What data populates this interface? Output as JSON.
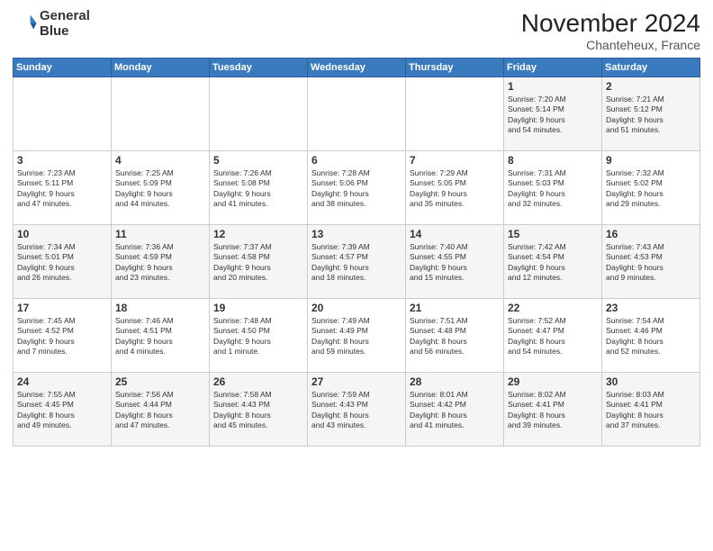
{
  "logo": {
    "line1": "General",
    "line2": "Blue"
  },
  "title": "November 2024",
  "location": "Chanteheux, France",
  "days_of_week": [
    "Sunday",
    "Monday",
    "Tuesday",
    "Wednesday",
    "Thursday",
    "Friday",
    "Saturday"
  ],
  "weeks": [
    [
      {
        "day": "",
        "info": ""
      },
      {
        "day": "",
        "info": ""
      },
      {
        "day": "",
        "info": ""
      },
      {
        "day": "",
        "info": ""
      },
      {
        "day": "",
        "info": ""
      },
      {
        "day": "1",
        "info": "Sunrise: 7:20 AM\nSunset: 5:14 PM\nDaylight: 9 hours\nand 54 minutes."
      },
      {
        "day": "2",
        "info": "Sunrise: 7:21 AM\nSunset: 5:12 PM\nDaylight: 9 hours\nand 51 minutes."
      }
    ],
    [
      {
        "day": "3",
        "info": "Sunrise: 7:23 AM\nSunset: 5:11 PM\nDaylight: 9 hours\nand 47 minutes."
      },
      {
        "day": "4",
        "info": "Sunrise: 7:25 AM\nSunset: 5:09 PM\nDaylight: 9 hours\nand 44 minutes."
      },
      {
        "day": "5",
        "info": "Sunrise: 7:26 AM\nSunset: 5:08 PM\nDaylight: 9 hours\nand 41 minutes."
      },
      {
        "day": "6",
        "info": "Sunrise: 7:28 AM\nSunset: 5:06 PM\nDaylight: 9 hours\nand 38 minutes."
      },
      {
        "day": "7",
        "info": "Sunrise: 7:29 AM\nSunset: 5:05 PM\nDaylight: 9 hours\nand 35 minutes."
      },
      {
        "day": "8",
        "info": "Sunrise: 7:31 AM\nSunset: 5:03 PM\nDaylight: 9 hours\nand 32 minutes."
      },
      {
        "day": "9",
        "info": "Sunrise: 7:32 AM\nSunset: 5:02 PM\nDaylight: 9 hours\nand 29 minutes."
      }
    ],
    [
      {
        "day": "10",
        "info": "Sunrise: 7:34 AM\nSunset: 5:01 PM\nDaylight: 9 hours\nand 26 minutes."
      },
      {
        "day": "11",
        "info": "Sunrise: 7:36 AM\nSunset: 4:59 PM\nDaylight: 9 hours\nand 23 minutes."
      },
      {
        "day": "12",
        "info": "Sunrise: 7:37 AM\nSunset: 4:58 PM\nDaylight: 9 hours\nand 20 minutes."
      },
      {
        "day": "13",
        "info": "Sunrise: 7:39 AM\nSunset: 4:57 PM\nDaylight: 9 hours\nand 18 minutes."
      },
      {
        "day": "14",
        "info": "Sunrise: 7:40 AM\nSunset: 4:55 PM\nDaylight: 9 hours\nand 15 minutes."
      },
      {
        "day": "15",
        "info": "Sunrise: 7:42 AM\nSunset: 4:54 PM\nDaylight: 9 hours\nand 12 minutes."
      },
      {
        "day": "16",
        "info": "Sunrise: 7:43 AM\nSunset: 4:53 PM\nDaylight: 9 hours\nand 9 minutes."
      }
    ],
    [
      {
        "day": "17",
        "info": "Sunrise: 7:45 AM\nSunset: 4:52 PM\nDaylight: 9 hours\nand 7 minutes."
      },
      {
        "day": "18",
        "info": "Sunrise: 7:46 AM\nSunset: 4:51 PM\nDaylight: 9 hours\nand 4 minutes."
      },
      {
        "day": "19",
        "info": "Sunrise: 7:48 AM\nSunset: 4:50 PM\nDaylight: 9 hours\nand 1 minute."
      },
      {
        "day": "20",
        "info": "Sunrise: 7:49 AM\nSunset: 4:49 PM\nDaylight: 8 hours\nand 59 minutes."
      },
      {
        "day": "21",
        "info": "Sunrise: 7:51 AM\nSunset: 4:48 PM\nDaylight: 8 hours\nand 56 minutes."
      },
      {
        "day": "22",
        "info": "Sunrise: 7:52 AM\nSunset: 4:47 PM\nDaylight: 8 hours\nand 54 minutes."
      },
      {
        "day": "23",
        "info": "Sunrise: 7:54 AM\nSunset: 4:46 PM\nDaylight: 8 hours\nand 52 minutes."
      }
    ],
    [
      {
        "day": "24",
        "info": "Sunrise: 7:55 AM\nSunset: 4:45 PM\nDaylight: 8 hours\nand 49 minutes."
      },
      {
        "day": "25",
        "info": "Sunrise: 7:56 AM\nSunset: 4:44 PM\nDaylight: 8 hours\nand 47 minutes."
      },
      {
        "day": "26",
        "info": "Sunrise: 7:58 AM\nSunset: 4:43 PM\nDaylight: 8 hours\nand 45 minutes."
      },
      {
        "day": "27",
        "info": "Sunrise: 7:59 AM\nSunset: 4:43 PM\nDaylight: 8 hours\nand 43 minutes."
      },
      {
        "day": "28",
        "info": "Sunrise: 8:01 AM\nSunset: 4:42 PM\nDaylight: 8 hours\nand 41 minutes."
      },
      {
        "day": "29",
        "info": "Sunrise: 8:02 AM\nSunset: 4:41 PM\nDaylight: 8 hours\nand 39 minutes."
      },
      {
        "day": "30",
        "info": "Sunrise: 8:03 AM\nSunset: 4:41 PM\nDaylight: 8 hours\nand 37 minutes."
      }
    ]
  ]
}
